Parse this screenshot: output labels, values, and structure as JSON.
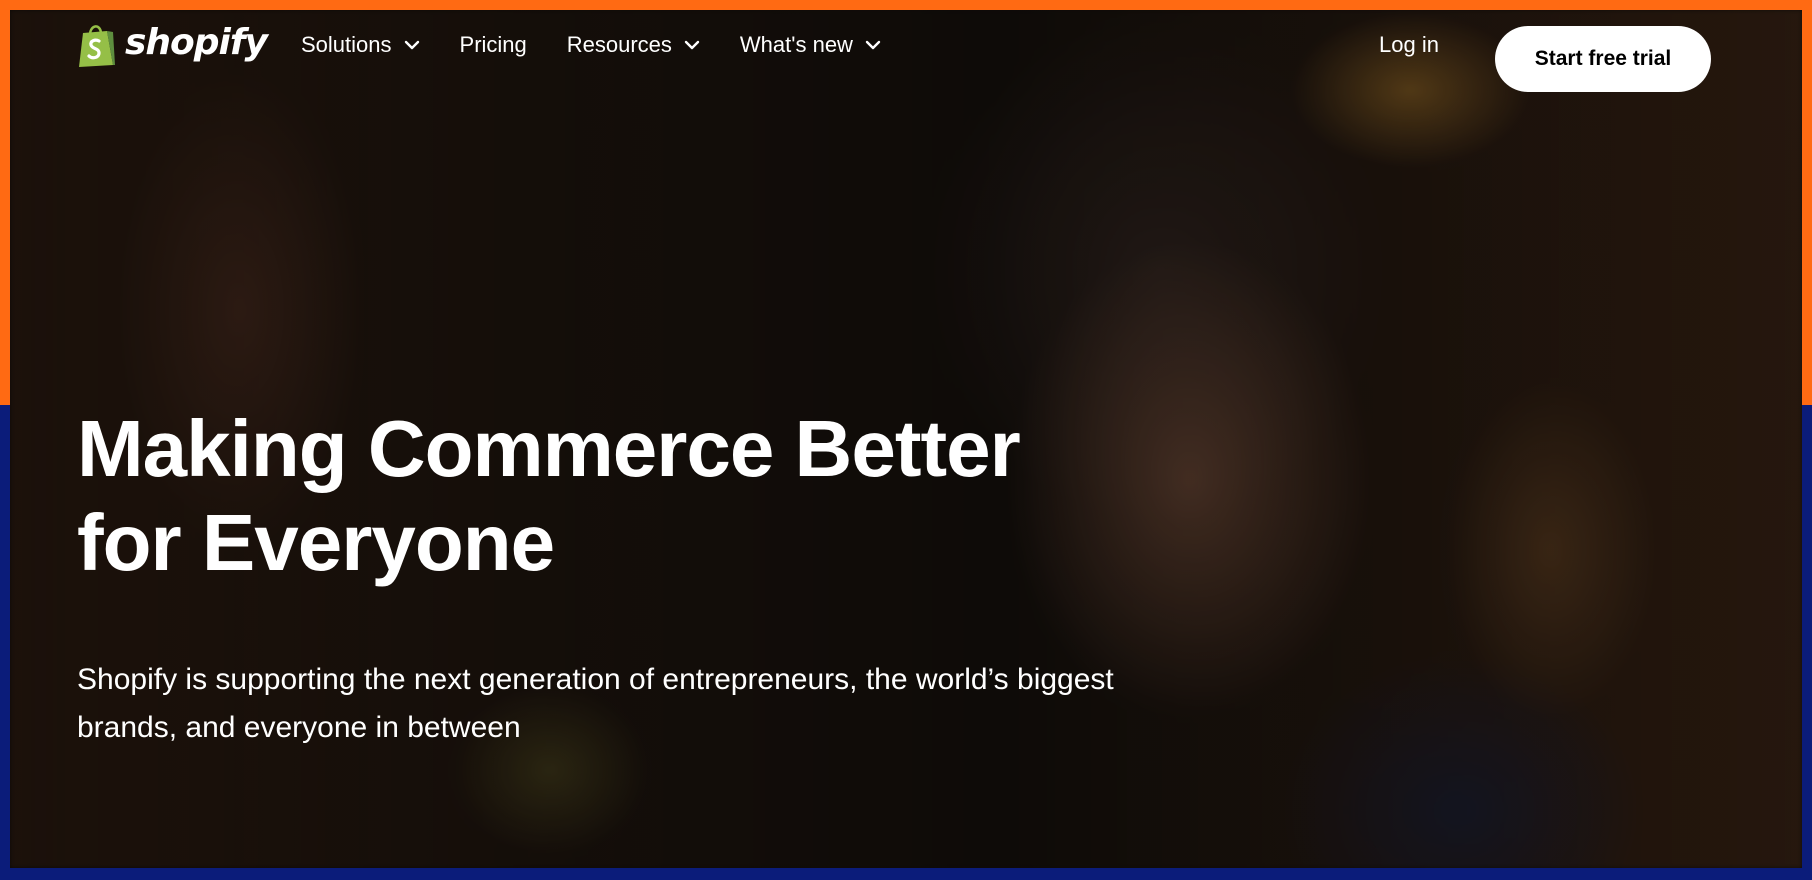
{
  "brand": {
    "name": "shopify",
    "logo_color": "#95bf47"
  },
  "nav": {
    "items": [
      {
        "label": "Solutions",
        "has_dropdown": true
      },
      {
        "label": "Pricing",
        "has_dropdown": false
      },
      {
        "label": "Resources",
        "has_dropdown": true
      },
      {
        "label": "What's new",
        "has_dropdown": true
      }
    ],
    "login_label": "Log in",
    "cta_label": "Start free trial"
  },
  "hero": {
    "title_line1": "Making Commerce Better",
    "title_line2": "for Everyone",
    "subtitle": "Shopify is supporting the next generation of entrepreneurs, the world’s biggest brands, and everyone in between"
  },
  "frame_colors": {
    "top": "#ff6a13",
    "bottom": "#0b1c7a"
  }
}
